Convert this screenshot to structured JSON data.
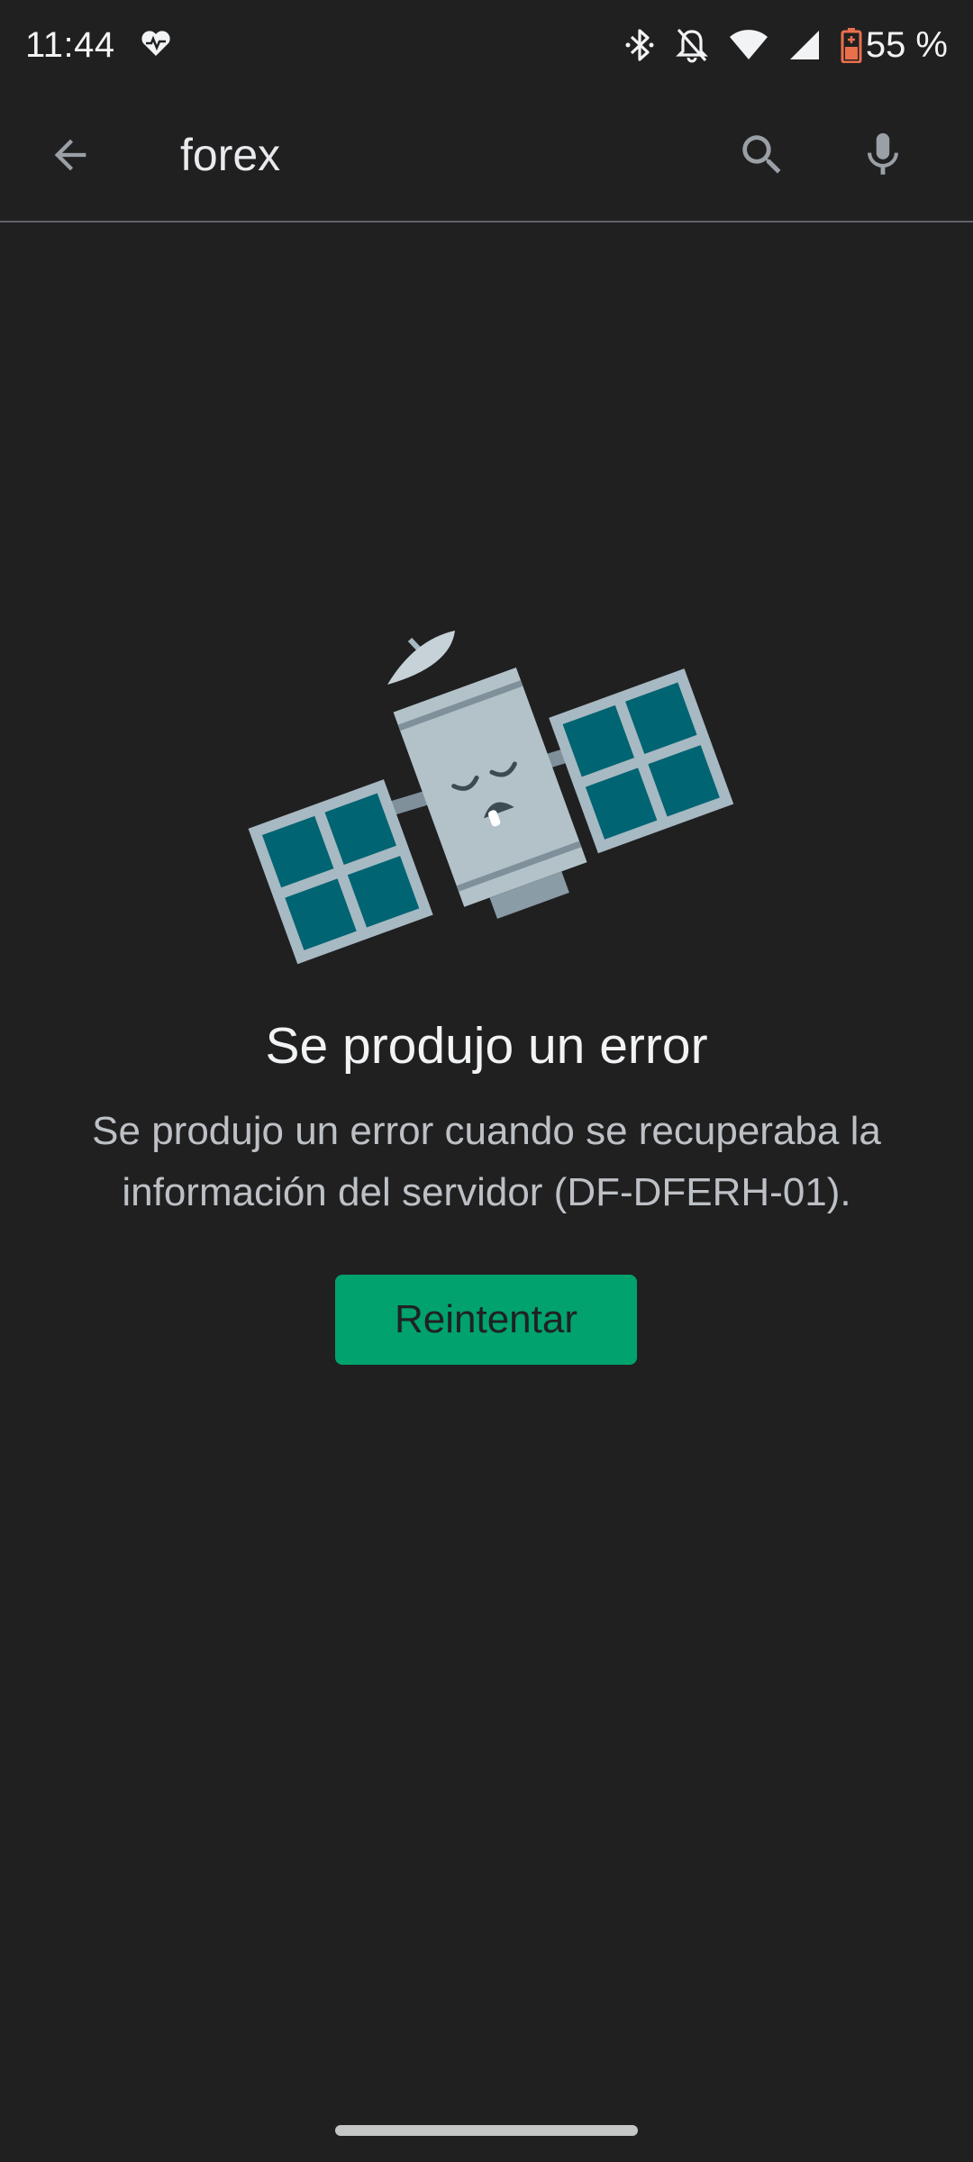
{
  "status_bar": {
    "time": "11:44",
    "battery_percent": "55 %",
    "icons": [
      "health-heart-icon",
      "bluetooth-icon",
      "notifications-off-icon",
      "wifi-icon",
      "cell-signal-icon",
      "battery-saver-icon"
    ]
  },
  "search": {
    "query": "forex",
    "icons": [
      "back-arrow-icon",
      "search-icon",
      "mic-icon"
    ]
  },
  "error": {
    "illustration": "sleeping-satellite-illustration",
    "title": "Se produjo un error",
    "message": "Se produjo un error cuando se recuperaba la información del servidor (DF-DFERH-01).",
    "retry_label": "Reintentar"
  },
  "colors": {
    "background": "#202021",
    "accent_button": "#01a26d",
    "battery_warning": "#ea6f4b",
    "panel_teal": "#006472"
  }
}
